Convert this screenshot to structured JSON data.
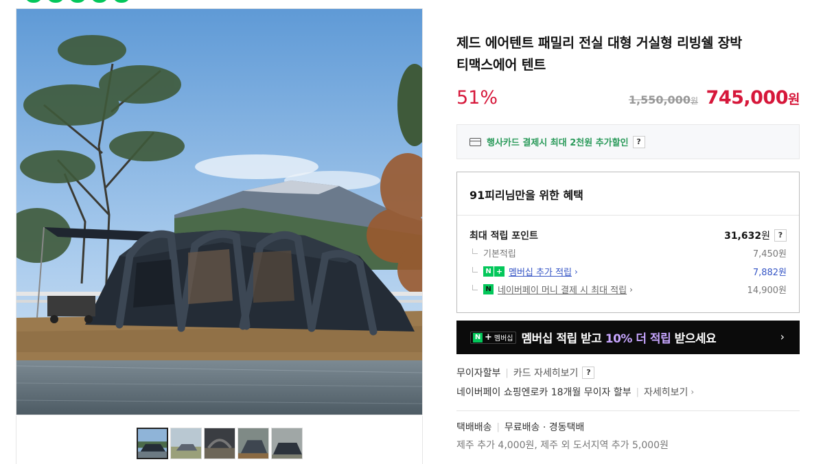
{
  "product": {
    "title_line1": "제드 에어텐트 패밀리 전실 대형 거실형 리빙쉘 장박",
    "title_line2": "티맥스에어 텐트",
    "discount": "51%",
    "original_price": "1,550,000",
    "original_currency": "원",
    "sale_price": "745,000",
    "sale_currency": "원"
  },
  "card_promo": {
    "icon": "credit-card-icon",
    "text": "행사카드 결제시 최대 2천원 추가할인",
    "help": "?"
  },
  "benefits": {
    "title": "91피리님만을 위한 혜택",
    "max_label": "최대 적립 포인트",
    "max_value": "31,632",
    "max_currency": "원",
    "help": "?",
    "rows": [
      {
        "label": "기본적립",
        "value": "7,450원"
      },
      {
        "badge_n": "N",
        "badge_plus": "+",
        "label": "멤버십 추가 적립",
        "value": "7,882원"
      },
      {
        "badge": "N",
        "label": "네이버페이 머니 결제 시 최대 적립",
        "value": "14,900원"
      }
    ]
  },
  "membership_banner": {
    "badge_n": "N",
    "badge_plus": "+",
    "badge_text": "멤버십",
    "text_pre": "멤버십 적립 받고 ",
    "text_highlight": "10% 더 적립",
    "text_post": " 받으세요",
    "arrow": "›"
  },
  "installment": {
    "label": "무이자할부",
    "card_detail": "카드 자세히보기",
    "help": "?",
    "shopping_text": "네이버페이 쇼핑엔로카 18개월 무이자 할부",
    "detail": "자세히보기",
    "chevron": "›"
  },
  "shipping": {
    "type": "택배배송",
    "info": "무료배송 · 경동택배",
    "extra": "제주 추가 4,000원, 제주 외 도서지역 추가 5,000원"
  },
  "gallery": {
    "thumb_count": 5,
    "active_index": 0
  },
  "colors": {
    "sale_red": "#d6173a",
    "naver_green": "#03c75a",
    "link_blue": "#3555c5",
    "banner_bg": "#0b0b0b",
    "highlight_purple": "#c7a6ff"
  }
}
